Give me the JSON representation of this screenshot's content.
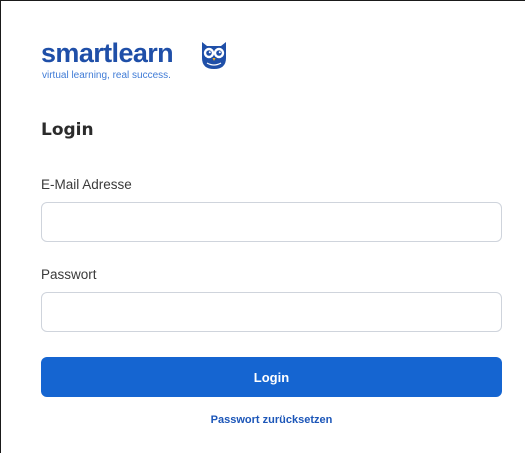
{
  "brand": {
    "name": "smartlearn",
    "tagline": "virtual learning, real success.",
    "primary_color": "#1f4fa8",
    "accent_color": "#3f7bd6",
    "logo_icon": "owl-icon"
  },
  "form": {
    "heading": "Login",
    "email_label": "E-Mail Adresse",
    "email_value": "",
    "password_label": "Passwort",
    "password_value": "",
    "submit_label": "Login",
    "submit_color": "#1565d1",
    "reset_link": "Passwort zurücksetzen"
  }
}
